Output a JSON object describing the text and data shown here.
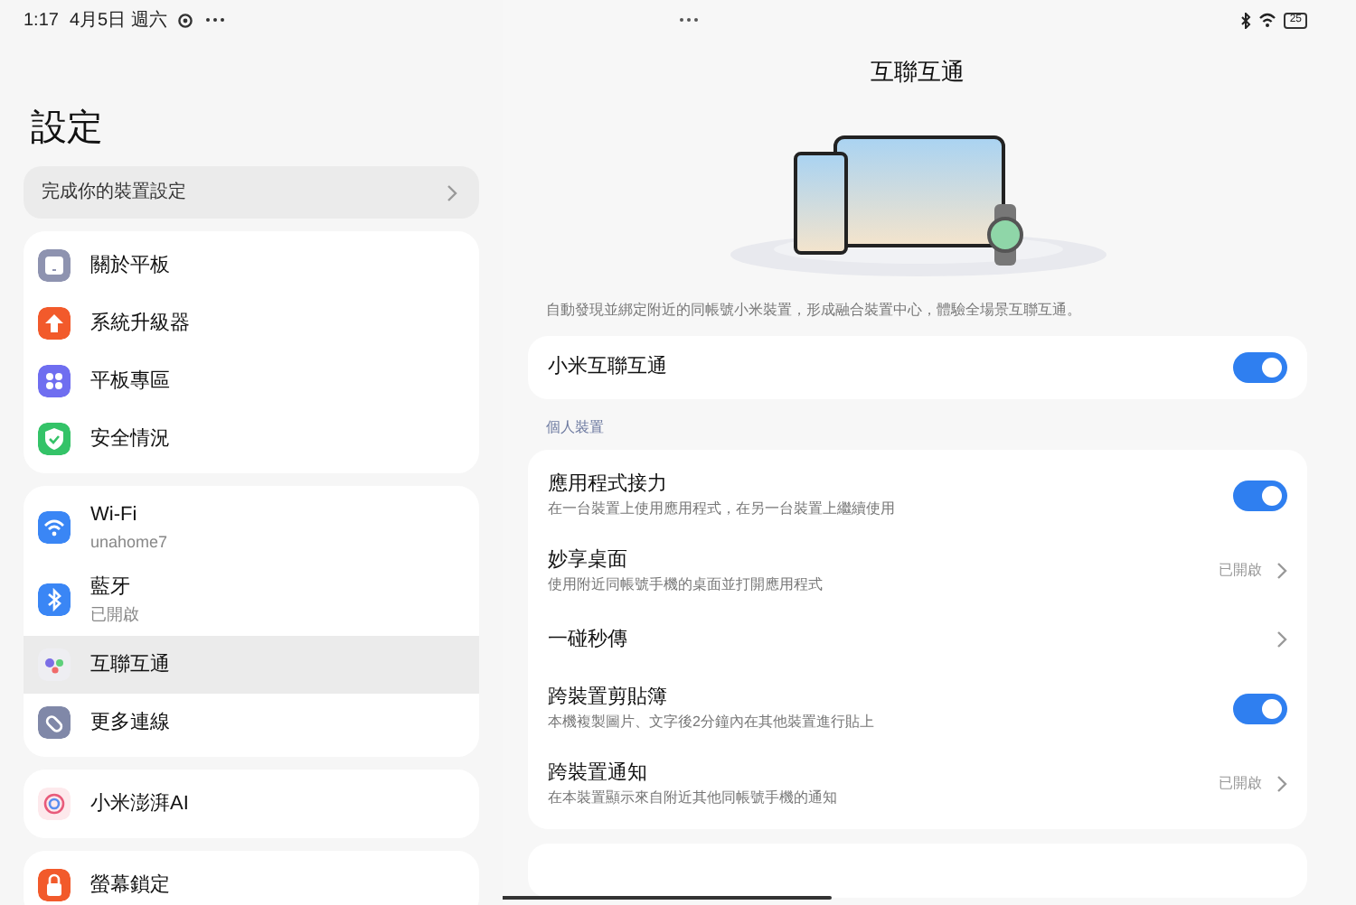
{
  "status_bar": {
    "time": "1:17",
    "date": "4月5日 週六",
    "battery": "25"
  },
  "sidebar": {
    "title": "設定",
    "setup_prompt": "完成你的裝置設定",
    "groups": [
      {
        "items": [
          {
            "label": "關於平板",
            "kind": "tablet",
            "color": "#8e93b0",
            "selected": false
          },
          {
            "label": "系統升級器",
            "kind": "arrow",
            "color": "#f25a2b",
            "selected": false
          },
          {
            "label": "平板專區",
            "kind": "grid",
            "color": "#6f6ef0",
            "selected": false
          },
          {
            "label": "安全情況",
            "kind": "shield",
            "color": "#34c368",
            "selected": false
          }
        ]
      },
      {
        "items": [
          {
            "label": "Wi-Fi",
            "sub": "unahome7",
            "kind": "wifi",
            "color": "#3a86f5",
            "selected": false
          },
          {
            "label": "藍牙",
            "sub": "已開啟",
            "kind": "bluetooth",
            "color": "#3a86f5",
            "selected": false
          },
          {
            "label": "互聯互通",
            "kind": "dots",
            "color": "#eeeef2",
            "selected": true
          },
          {
            "label": "更多連線",
            "kind": "link",
            "color": "#8088a8",
            "selected": false
          }
        ]
      },
      {
        "items": [
          {
            "label": "小米澎湃AI",
            "kind": "ai",
            "color": "#fde9ec",
            "selected": false
          }
        ]
      },
      {
        "items": [
          {
            "label": "螢幕鎖定",
            "kind": "lock",
            "color": "#f25a2b",
            "selected": false
          }
        ]
      }
    ]
  },
  "detail": {
    "title": "互聯互通",
    "description": "自動發現並綁定附近的同帳號小米裝置，形成融合裝置中心，體驗全場景互聯互通。",
    "master": {
      "label": "小米互聯互通",
      "on": true
    },
    "section_label": "個人裝置",
    "rows": [
      {
        "kind": "toggle",
        "label": "應用程式接力",
        "sub": "在一台裝置上使用應用程式，在另一台裝置上繼續使用",
        "on": true
      },
      {
        "kind": "link",
        "label": "妙享桌面",
        "sub": "使用附近同帳號手機的桌面並打開應用程式",
        "value": "已開啟"
      },
      {
        "kind": "link",
        "label": "一碰秒傳"
      },
      {
        "kind": "toggle",
        "label": "跨裝置剪貼簿",
        "sub": "本機複製圖片、文字後2分鐘內在其他裝置進行貼上",
        "on": true
      },
      {
        "kind": "link",
        "label": "跨裝置通知",
        "sub": "在本裝置顯示來自附近其他同帳號手機的通知",
        "value": "已開啟"
      }
    ]
  }
}
